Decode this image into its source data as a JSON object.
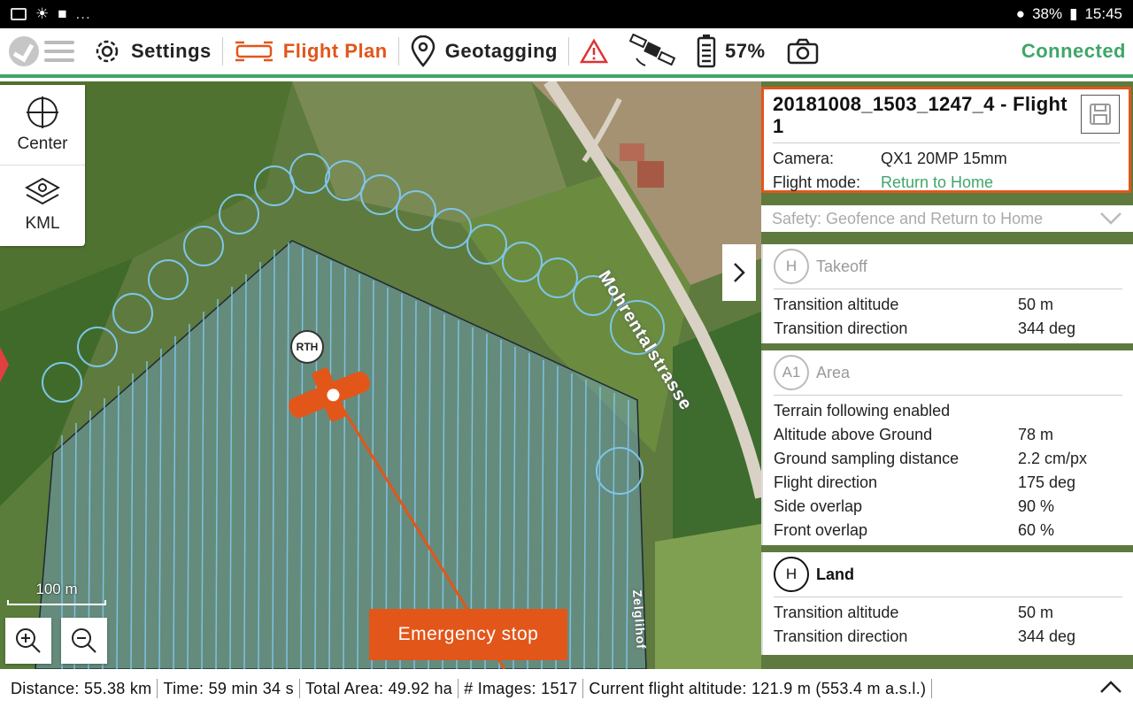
{
  "status_bar": {
    "left_icons": [
      "image-icon",
      "weather-icon",
      "video-icon"
    ],
    "more": "...",
    "battery": "38%",
    "time": "15:45"
  },
  "top_bar": {
    "settings": "Settings",
    "flight_plan": "Flight Plan",
    "geotagging": "Geotagging",
    "battery": "57%",
    "connection": "Connected",
    "accent_color": "#e2561a",
    "status_color": "#3fa66a"
  },
  "tools": {
    "center": "Center",
    "kml": "KML"
  },
  "map": {
    "rth_label": "RTH",
    "scale_label": "100 m",
    "street_main": "Mohrentalstrasse",
    "street_side": "Zelglihof",
    "emergency_stop": "Emergency stop"
  },
  "flight": {
    "title": "20181008_1503_1247_4 - Flight 1",
    "camera_label": "Camera:",
    "camera_value": "QX1 20MP 15mm",
    "mode_label": "Flight mode:",
    "mode_value": "Return to Home"
  },
  "safety": "Safety: Geofence and Return to Home",
  "takeoff": {
    "badge": "H",
    "title": "Takeoff",
    "rows": [
      {
        "k": "Transition altitude",
        "v": "50 m"
      },
      {
        "k": "Transition direction",
        "v": "344 deg"
      }
    ]
  },
  "area": {
    "badge": "A1",
    "title": "Area",
    "rows": [
      {
        "k": "Terrain following enabled",
        "v": ""
      },
      {
        "k": "Altitude above Ground",
        "v": "78 m"
      },
      {
        "k": "Ground sampling distance",
        "v": "2.2 cm/px"
      },
      {
        "k": "Flight direction",
        "v": "175 deg"
      },
      {
        "k": "Side overlap",
        "v": "90 %"
      },
      {
        "k": "Front overlap",
        "v": "60 %"
      }
    ]
  },
  "land": {
    "badge": "H",
    "title": "Land",
    "rows": [
      {
        "k": "Transition altitude",
        "v": "50 m"
      },
      {
        "k": "Transition direction",
        "v": "344 deg"
      }
    ]
  },
  "bottom": {
    "distance": "Distance: 55.38 km",
    "time": "Time: 59 min 34 s",
    "area": "Total Area: 49.92 ha",
    "images": "# Images: 1517",
    "altitude": "Current flight altitude: 121.9 m (553.4 m a.s.l.)"
  }
}
